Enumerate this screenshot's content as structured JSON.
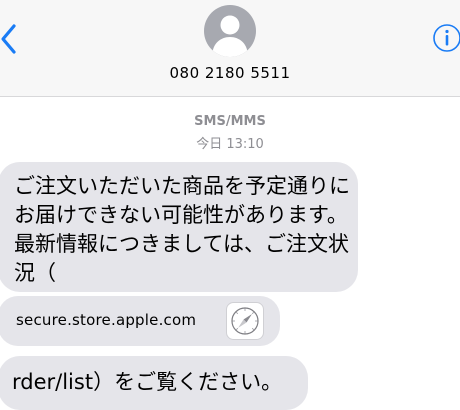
{
  "header": {
    "contact_number": "080 2180 5511",
    "back_icon": "chevron-left-icon",
    "info_icon": "info-icon",
    "avatar_icon": "person-silhouette-icon",
    "accent_color": "#1a7cf5"
  },
  "conversation": {
    "service_label": "SMS/MMS",
    "day_label": "今日",
    "time_label": "13:10"
  },
  "messages": [
    {
      "type": "text",
      "text": "ご注文いただいた商品を予定通りにお届けできない可能性があります。最新情報につきましては、ご注文状況（"
    },
    {
      "type": "link-preview",
      "text": "secure.store.apple.com",
      "icon": "safari-compass-icon"
    },
    {
      "type": "text",
      "text": "rder/list）をご覧ください。"
    }
  ],
  "colors": {
    "header_bg": "#f7f7f7",
    "incoming_bubble": "#e5e5ea",
    "meta_gray": "#8e8e93"
  }
}
